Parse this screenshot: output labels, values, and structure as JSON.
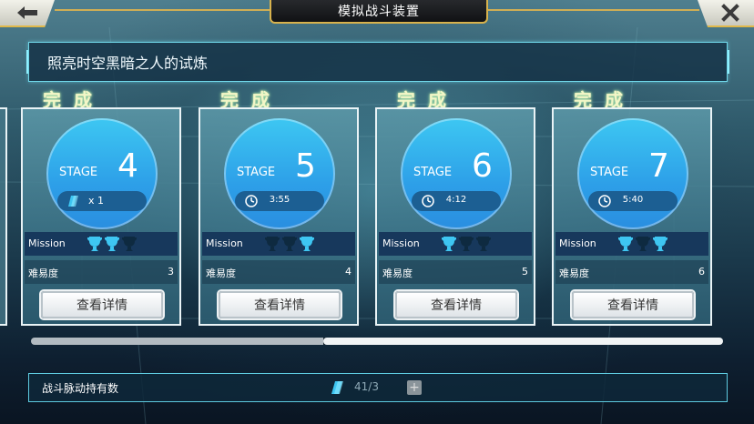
{
  "header": {
    "title": "模拟战斗装置",
    "back_icon": "back-arrow-icon",
    "close_icon": "close-x-icon"
  },
  "banner": {
    "text": "照亮时空黑暗之人的试炼"
  },
  "cards": [
    {
      "status": "完成",
      "stage_label": "STAGE",
      "stage": "4",
      "pill_type": "item",
      "pill_text": "x 1",
      "mission_label": "Mission",
      "trophies": [
        true,
        true,
        false
      ],
      "difficulty_label": "难易度",
      "difficulty": "3",
      "button": "查看详情"
    },
    {
      "status": "完成",
      "stage_label": "STAGE",
      "stage": "5",
      "pill_type": "time",
      "pill_text": "3:55",
      "mission_label": "Mission",
      "trophies": [
        false,
        false,
        true
      ],
      "difficulty_label": "难易度",
      "difficulty": "4",
      "button": "查看详情"
    },
    {
      "status": "完成",
      "stage_label": "STAGE",
      "stage": "6",
      "pill_type": "time",
      "pill_text": "4:12",
      "mission_label": "Mission",
      "trophies": [
        true,
        false,
        false
      ],
      "difficulty_label": "难易度",
      "difficulty": "5",
      "button": "查看详情"
    },
    {
      "status": "完成",
      "stage_label": "STAGE",
      "stage": "7",
      "pill_type": "time",
      "pill_text": "5:40",
      "mission_label": "Mission",
      "trophies": [
        true,
        false,
        true
      ],
      "difficulty_label": "难易度",
      "difficulty": "6",
      "button": "查看详情"
    }
  ],
  "scrollbar": {
    "position_fraction": 0.42
  },
  "footer": {
    "label": "战斗脉动持有数",
    "count": "41/3",
    "plus_icon": "plus-icon"
  },
  "colors": {
    "accent_gold": "#d8b24d",
    "circle_blue": "#2d9fe8",
    "trophy_active": "#3ec6f2",
    "trophy_inactive": "#0e2a40",
    "done_text": "#f3f6c7"
  }
}
